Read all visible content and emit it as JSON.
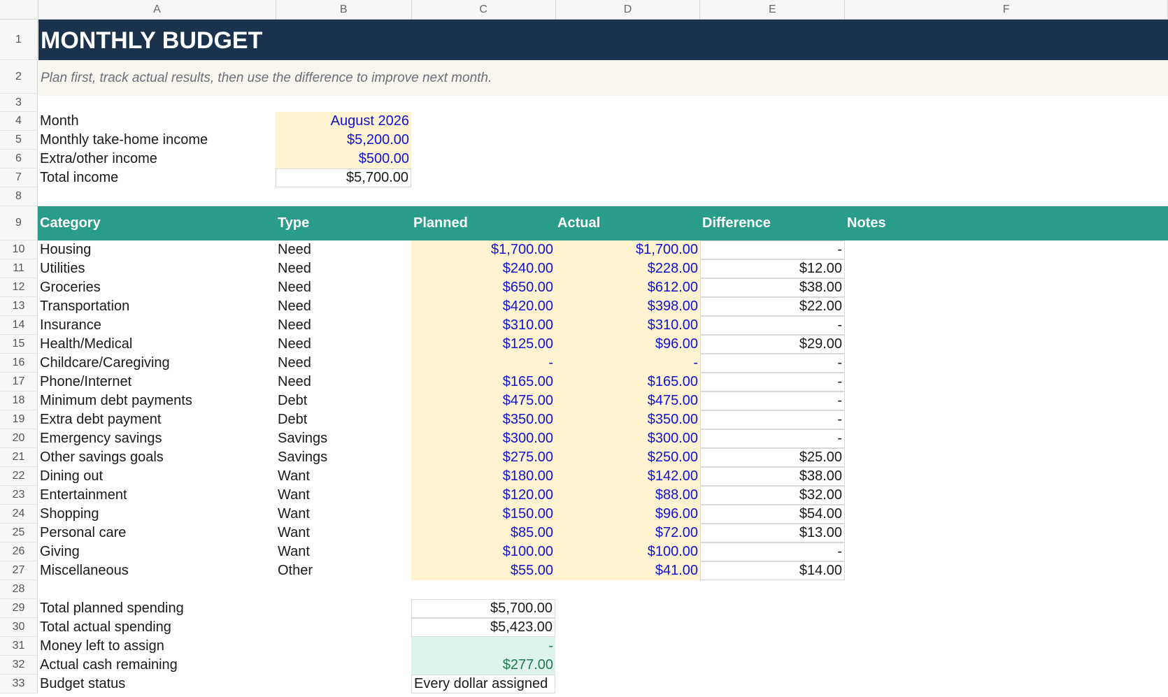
{
  "columns": [
    "A",
    "B",
    "C",
    "D",
    "E",
    "F"
  ],
  "title": "MONTHLY BUDGET",
  "subtitle": "Plan first, track actual results, then use the difference to improve next month.",
  "income": {
    "month_label": "Month",
    "month_value": "August 2026",
    "takehome_label": "Monthly take-home income",
    "takehome_value": "$5,200.00",
    "extra_label": "Extra/other income",
    "extra_value": "$500.00",
    "total_label": "Total income",
    "total_value": "$5,700.00"
  },
  "table": {
    "headers": [
      "Category",
      "Type",
      "Planned",
      "Actual",
      "Difference",
      "Notes"
    ],
    "rows": [
      {
        "category": "Housing",
        "type": "Need",
        "planned": "$1,700.00",
        "actual": "$1,700.00",
        "difference": "-"
      },
      {
        "category": "Utilities",
        "type": "Need",
        "planned": "$240.00",
        "actual": "$228.00",
        "difference": "$12.00"
      },
      {
        "category": "Groceries",
        "type": "Need",
        "planned": "$650.00",
        "actual": "$612.00",
        "difference": "$38.00"
      },
      {
        "category": "Transportation",
        "type": "Need",
        "planned": "$420.00",
        "actual": "$398.00",
        "difference": "$22.00"
      },
      {
        "category": "Insurance",
        "type": "Need",
        "planned": "$310.00",
        "actual": "$310.00",
        "difference": "-"
      },
      {
        "category": "Health/Medical",
        "type": "Need",
        "planned": "$125.00",
        "actual": "$96.00",
        "difference": "$29.00"
      },
      {
        "category": "Childcare/Caregiving",
        "type": "Need",
        "planned": "-",
        "actual": "-",
        "difference": "-"
      },
      {
        "category": "Phone/Internet",
        "type": "Need",
        "planned": "$165.00",
        "actual": "$165.00",
        "difference": "-"
      },
      {
        "category": "Minimum debt payments",
        "type": "Debt",
        "planned": "$475.00",
        "actual": "$475.00",
        "difference": "-"
      },
      {
        "category": "Extra debt payment",
        "type": "Debt",
        "planned": "$350.00",
        "actual": "$350.00",
        "difference": "-"
      },
      {
        "category": "Emergency savings",
        "type": "Savings",
        "planned": "$300.00",
        "actual": "$300.00",
        "difference": "-"
      },
      {
        "category": "Other savings goals",
        "type": "Savings",
        "planned": "$275.00",
        "actual": "$250.00",
        "difference": "$25.00"
      },
      {
        "category": "Dining out",
        "type": "Want",
        "planned": "$180.00",
        "actual": "$142.00",
        "difference": "$38.00"
      },
      {
        "category": "Entertainment",
        "type": "Want",
        "planned": "$120.00",
        "actual": "$88.00",
        "difference": "$32.00"
      },
      {
        "category": "Shopping",
        "type": "Want",
        "planned": "$150.00",
        "actual": "$96.00",
        "difference": "$54.00"
      },
      {
        "category": "Personal care",
        "type": "Want",
        "planned": "$85.00",
        "actual": "$72.00",
        "difference": "$13.00"
      },
      {
        "category": "Giving",
        "type": "Want",
        "planned": "$100.00",
        "actual": "$100.00",
        "difference": "-"
      },
      {
        "category": "Miscellaneous",
        "type": "Other",
        "planned": "$55.00",
        "actual": "$41.00",
        "difference": "$14.00"
      }
    ]
  },
  "summary": {
    "planned_label": "Total planned spending",
    "planned_value": "$5,700.00",
    "actual_label": "Total actual spending",
    "actual_value": "$5,423.00",
    "left_label": "Money left to assign",
    "left_value": "-",
    "remaining_label": "Actual cash remaining",
    "remaining_value": "$277.00",
    "status_label": "Budget status",
    "status_value": "Every dollar assigned"
  },
  "colors": {
    "title_bg": "#1b324c",
    "header_bg": "#2a9d8a",
    "input_bg": "#fdf3d1",
    "input_text": "#1212d4",
    "summary_bg": "#ddf3ec",
    "summary_text": "#1f7a4e"
  }
}
